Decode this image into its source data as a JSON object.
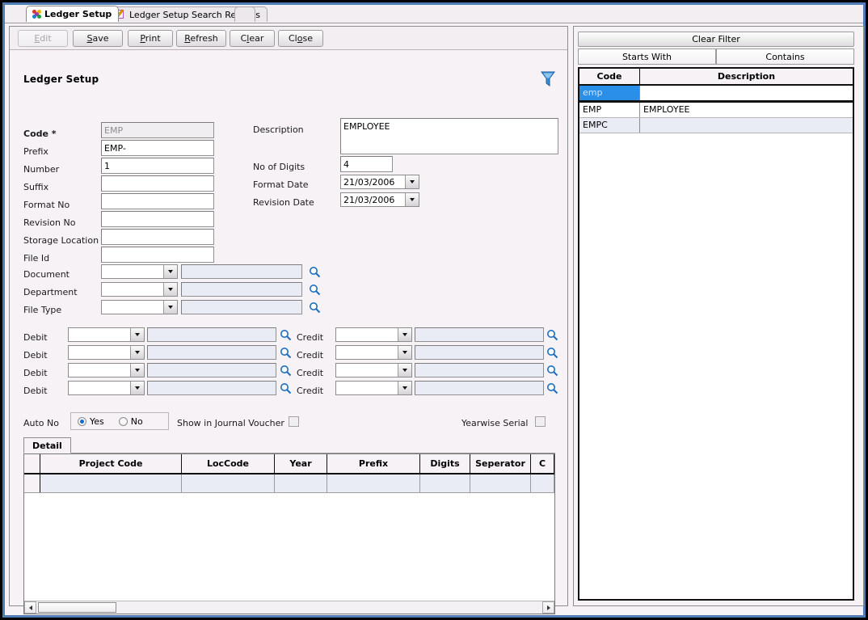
{
  "window": {
    "tabs": [
      {
        "label": "Ledger Setup",
        "icon": "pinwheel-icon",
        "active": true
      },
      {
        "label": "Ledger Setup Search Records",
        "icon": "pencil-page-icon",
        "active": false
      }
    ]
  },
  "toolbar": {
    "buttons": [
      {
        "label": "Edit",
        "mnemonic": "E",
        "disabled": true
      },
      {
        "label": "Save",
        "mnemonic": "S",
        "disabled": false
      },
      {
        "label": "Print",
        "mnemonic": "P",
        "disabled": false
      },
      {
        "label": "Refresh",
        "mnemonic": "R",
        "disabled": false
      },
      {
        "label": "Clear",
        "mnemonic": "l",
        "disabled": false
      },
      {
        "label": "Close",
        "mnemonic": "o",
        "disabled": false
      }
    ]
  },
  "form": {
    "title": "Ledger Setup",
    "filter_icon": "funnel-filter-icon",
    "left_fields": [
      {
        "label": "Code *",
        "value": "EMP",
        "readonly": true
      },
      {
        "label": "Prefix",
        "value": "EMP-",
        "readonly": false
      },
      {
        "label": "Number",
        "value": "1",
        "readonly": false
      },
      {
        "label": "Suffix",
        "value": "",
        "readonly": false
      },
      {
        "label": "Format No",
        "value": "",
        "readonly": false
      },
      {
        "label": "Revision No",
        "value": "",
        "readonly": false
      },
      {
        "label": "Storage Location",
        "value": "",
        "readonly": false
      },
      {
        "label": "File Id",
        "value": "",
        "readonly": false
      }
    ],
    "description": {
      "label": "Description",
      "value": "EMPLOYEE"
    },
    "no_of_digits": {
      "label": "No of Digits",
      "value": "4"
    },
    "format_date": {
      "label": "Format Date",
      "value": "21/03/2006"
    },
    "revision_date": {
      "label": "Revision Date",
      "value": "21/03/2006"
    },
    "lookup_rows": [
      {
        "label": "Document",
        "combo": "",
        "text": ""
      },
      {
        "label": "Department",
        "combo": "",
        "text": ""
      },
      {
        "label": "File Type",
        "combo": "",
        "text": ""
      }
    ],
    "debit_credit_rows": [
      {
        "debit_label": "Debit",
        "debit_combo": "",
        "debit_text": "",
        "credit_label": "Credit",
        "credit_combo": "",
        "credit_text": ""
      },
      {
        "debit_label": "Debit",
        "debit_combo": "",
        "debit_text": "",
        "credit_label": "Credit",
        "credit_combo": "",
        "credit_text": ""
      },
      {
        "debit_label": "Debit",
        "debit_combo": "",
        "debit_text": "",
        "credit_label": "Credit",
        "credit_combo": "",
        "credit_text": ""
      },
      {
        "debit_label": "Debit",
        "debit_combo": "",
        "debit_text": "",
        "credit_label": "Credit",
        "credit_combo": "",
        "credit_text": ""
      }
    ],
    "auto_no": {
      "label": "Auto No",
      "yes_label": "Yes",
      "no_label": "No",
      "selected": "Yes"
    },
    "show_in_journal_voucher": {
      "label": "Show in Journal Voucher",
      "checked": false
    },
    "yearwise_serial": {
      "label": "Yearwise Serial",
      "checked": false
    }
  },
  "detail": {
    "tab_label": "Detail",
    "columns": [
      "",
      "Project Code",
      "LocCode",
      "Year",
      "Prefix",
      "Digits",
      "Seperator",
      "C"
    ],
    "rows": [
      [
        "",
        "",
        "",
        "",
        "",
        "",
        "",
        ""
      ]
    ],
    "scroll": {
      "left_arrow": "◀",
      "right_arrow": "▶"
    }
  },
  "search_panel": {
    "clear_filter_label": "Clear Filter",
    "mode_tabs": [
      {
        "label": "Starts With",
        "active": true
      },
      {
        "label": "Contains",
        "active": false
      }
    ],
    "columns": [
      "Code",
      "Description"
    ],
    "filter_row": {
      "code": "emp",
      "description": ""
    },
    "rows": [
      {
        "code": "EMP",
        "description": "EMPLOYEE"
      },
      {
        "code": "EMPC",
        "description": ""
      }
    ]
  },
  "colors": {
    "frame_blue": "#4f7cb5",
    "background": "#f7f2f6",
    "field_blue": "#e9ebf5",
    "highlight_blue": "#2a8fe8",
    "accent_icon_blue": "#1f7fd0"
  }
}
